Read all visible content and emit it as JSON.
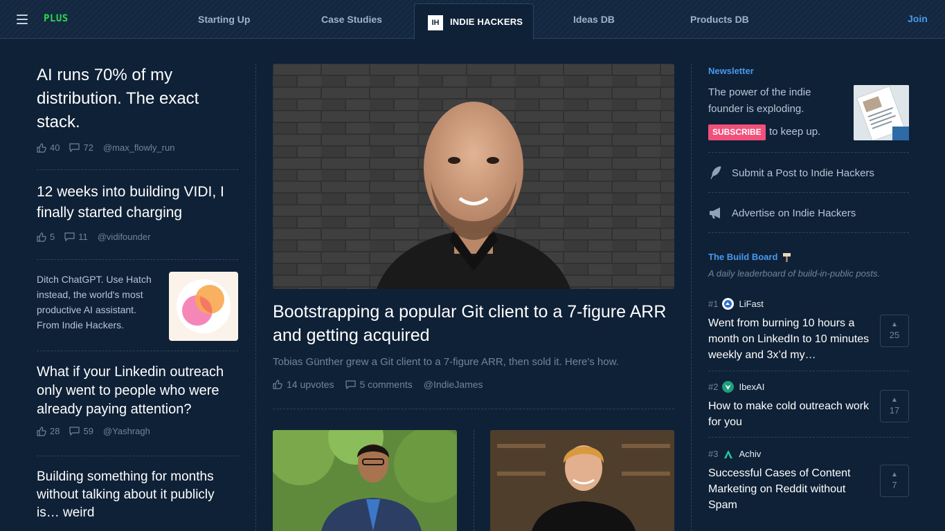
{
  "nav": {
    "brand": "PLUS",
    "links": [
      "Starting Up",
      "Case Studies",
      "Ideas DB",
      "Products DB"
    ],
    "active_logo": "IH",
    "active_label": "INDIE HACKERS",
    "join": "Join"
  },
  "left": {
    "posts": [
      {
        "title": "AI runs 70% of my distribution. The exact stack.",
        "likes": "40",
        "comments": "72",
        "author": "@max_flowly_run"
      },
      {
        "title": "12 weeks into building VIDI, I finally started charging",
        "likes": "5",
        "comments": "11",
        "author": "@vidifounder"
      },
      {
        "title": "What if your Linkedin outreach only went to people who were already paying attention?",
        "likes": "28",
        "comments": "59",
        "author": "@Yashragh"
      },
      {
        "title": "Building something for months without talking about it publicly is… weird"
      }
    ],
    "ad": {
      "text": "Ditch ChatGPT. Use Hatch instead, the world's most productive AI assistant. From Indie Hackers."
    }
  },
  "hero": {
    "title": "Bootstrapping a popular Git client to a 7-figure ARR and getting acquired",
    "description": "Tobias Günther grew a Git client to a 7-figure ARR, then sold it. Here's how.",
    "upvotes": "14 upvotes",
    "comments": "5 comments",
    "author": "@IndieJames"
  },
  "right": {
    "newsletter": {
      "label": "Newsletter",
      "text": "The power of the indie founder is exploding.",
      "subscribe": "SUBSCRIBE",
      "suffix": "to keep up."
    },
    "actions": {
      "submit": "Submit a Post to Indie Hackers",
      "advertise": "Advertise on Indie Hackers"
    },
    "build_board": {
      "label": "The Build Board",
      "subtitle": "A daily leaderboard of build-in-public posts.",
      "items": [
        {
          "rank": "#1",
          "name": "LiFast",
          "title": "Went from burning 10 hours a month on LinkedIn to 10 minutes weekly and 3x’d my…",
          "votes": "25"
        },
        {
          "rank": "#2",
          "name": "IbexAI",
          "title": "How to make cold outreach work for you",
          "votes": "17"
        },
        {
          "rank": "#3",
          "name": "Achiv",
          "title": "Successful Cases of Content Marketing on Reddit without Spam",
          "votes": "7"
        }
      ]
    }
  },
  "colors": {
    "background": "#0f2137",
    "accent": "#4799eb",
    "brand_green": "#2bd94c",
    "subscribe": "#f0507a"
  }
}
